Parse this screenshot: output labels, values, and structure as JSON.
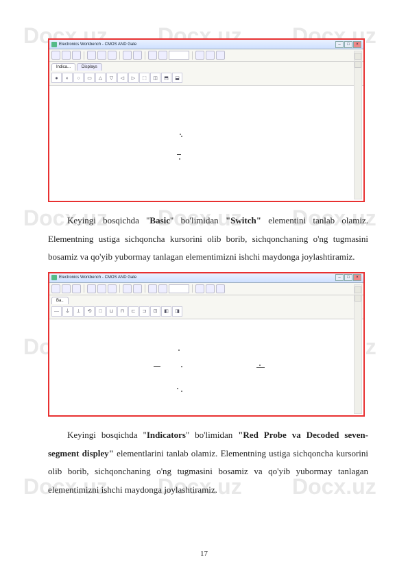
{
  "watermark": {
    "text": "Docx.uz"
  },
  "screenshot1": {
    "title": "Electronics Workbench - CMOS AND Gate",
    "tabs": {
      "indic": "Indica...",
      "displays": "Displays"
    },
    "ribbon_glyphs": [
      "●",
      "◐",
      "○",
      "▭",
      "△",
      "▽",
      "◁",
      "▷",
      "⬚",
      "◫",
      "⬒",
      "⬓"
    ]
  },
  "para1": {
    "pre": "Keyingi bosqichda \"",
    "b1": "Basic",
    "mid1": "\" bo'limidan ",
    "b2": "\"Switch\"",
    "post": " elementini tanlab olamiz. Elementning ustiga sichqoncha kursorini olib borib, sichqonchaning o'ng tugmasini bosamiz va qo'yib yubormay tanlagan elementimizni ishchi maydonga joylashtiramiz."
  },
  "screenshot2": {
    "title": "Electronics Workbench - CMOS AND Gate",
    "tabs": {
      "basic": "Ba.."
    },
    "ribbon_glyphs": [
      "—",
      "⏚",
      "⊥",
      "⟲",
      "□",
      "⊔",
      "⊓",
      "⊏",
      "⊐",
      "⊡",
      "◧",
      "◨"
    ]
  },
  "para2": {
    "pre": "Keyingi bosqichda \"",
    "b1": "Indicators",
    "mid1": "\" bo'limidan ",
    "b2": "\"Red Probe va Decoded seven-segment displey\"",
    "post": " elementlarini tanlab olamiz. Elementning ustiga sichqoncha kursorini olib borib, sichqonchaning o'ng tugmasini bosamiz va qo'yib yubormay tanlagan elementimizni ishchi maydonga joylashtiramiz."
  },
  "pagenum": "17"
}
